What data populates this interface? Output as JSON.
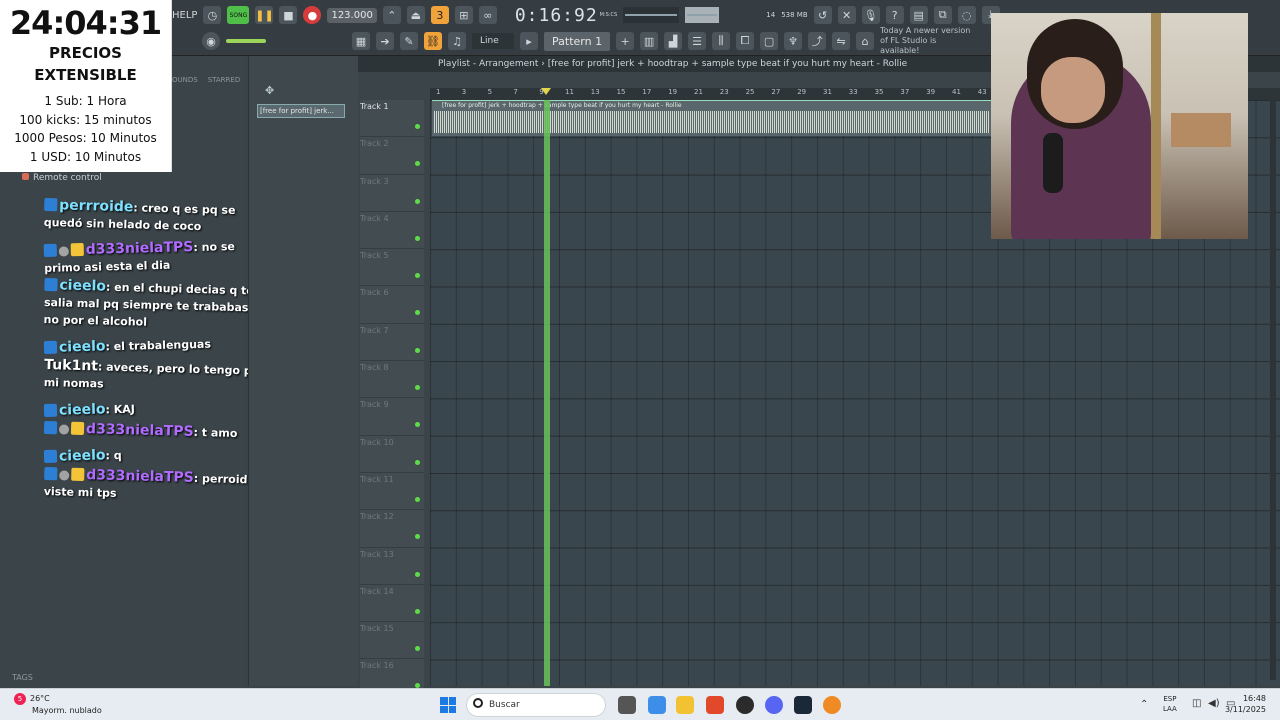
{
  "overlay": {
    "timer": "24:04:31",
    "price_title_1": "PRECIOS",
    "price_title_2": "EXTENSIBLE",
    "rates": [
      "1 Sub: 1 Hora",
      "100 kicks: 15 minutos",
      "1000 Pesos: 10 Minutos",
      "1 USD: 10 Minutos"
    ]
  },
  "toolbar": {
    "help_label": "HELP",
    "song_label": "SONG",
    "tempo": "123.000",
    "time": "0:16:92",
    "time_unit": "M:S:CS",
    "cpu_value": "14",
    "memory": "538 MB",
    "line_mode": "Line",
    "pattern": "Pattern 1",
    "news": "Today  A newer version of FL Studio is available!"
  },
  "browser": {
    "tab_sounds": "OUNDS",
    "tab_starred": "STARRED",
    "remote_control": "Remote control",
    "tags": "TAGS"
  },
  "chat": [
    {
      "user": "perrroide",
      "color": "#7ee0ff",
      "badges": [
        "prime"
      ],
      "text": ": creo q es pq se quedó sin helado de coco"
    },
    {
      "user": "d333nielaTPS",
      "color": "#b06bff",
      "badges": [
        "prime",
        "gray",
        "crown"
      ],
      "text": ": no se primo asi esta el dia"
    },
    {
      "user": "cieelo",
      "color": "#7ee0ff",
      "badges": [
        "prime"
      ],
      "text": ": en el chupi decias q te salia mal pq siempre te trababas y no por el alcohol"
    },
    {
      "user": "cieelo",
      "color": "#7ee0ff",
      "badges": [
        "prime"
      ],
      "text": ": el trabalenguas"
    },
    {
      "user": "Tuk1nt",
      "color": "#ffffff",
      "badges": [],
      "text": ": aveces, pero lo tengo para mi nomas"
    },
    {
      "user": "cieelo",
      "color": "#7ee0ff",
      "badges": [
        "prime"
      ],
      "text": ": KAJ"
    },
    {
      "user": "d333nielaTPS",
      "color": "#b06bff",
      "badges": [
        "prime",
        "gray",
        "crown"
      ],
      "text": ": t amo"
    },
    {
      "user": "cieelo",
      "color": "#7ee0ff",
      "badges": [
        "prime"
      ],
      "text": ": q"
    },
    {
      "user": "d333nielaTPS",
      "color": "#b06bff",
      "badges": [
        "prime",
        "gray",
        "crown"
      ],
      "text": ": perroide viste mi tps"
    }
  ],
  "pattern_strip": {
    "clip_label": "[free for profit] jerk..."
  },
  "playlist": {
    "title": "Playlist - Arrangement",
    "breadcrumb": "[free for profit] jerk + hoodtrap + sample type beat if you hurt my heart - Rollie",
    "clip_name": "[free for profit] jerk + hoodtrap + sample type beat if you hurt my heart - Rollie",
    "ruler": [
      "1",
      "3",
      "5",
      "7",
      "9",
      "11",
      "13",
      "15",
      "17",
      "19",
      "21",
      "23",
      "25",
      "27",
      "29",
      "31",
      "33",
      "35",
      "37",
      "39",
      "41",
      "43"
    ],
    "tracks": [
      "Track 1",
      "Track 2",
      "Track 3",
      "Track 4",
      "Track 5",
      "Track 6",
      "Track 7",
      "Track 8",
      "Track 9",
      "Track 10",
      "Track 11",
      "Track 12",
      "Track 13",
      "Track 14",
      "Track 15",
      "Track 16"
    ]
  },
  "taskbar": {
    "temperature": "26°C",
    "weather": "Mayorm. nublado",
    "search_placeholder": "Buscar",
    "lang_1": "ESP",
    "lang_2": "LAA",
    "time": "16:48",
    "date": "3/11/2025",
    "notification_count": "5"
  }
}
